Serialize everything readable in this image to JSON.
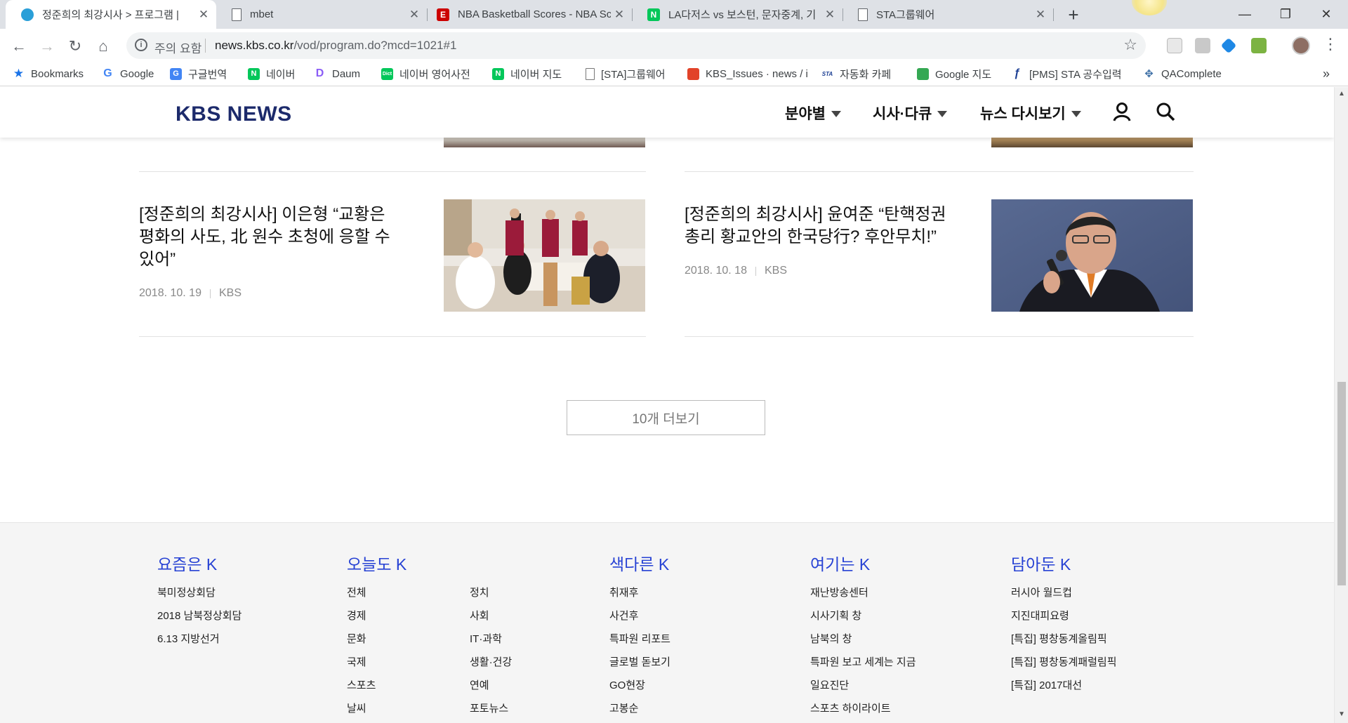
{
  "browser": {
    "tabs": [
      {
        "title": "정준희의 최강시사 > 프로그램 |",
        "icon": "kbs-icon",
        "active": true
      },
      {
        "title": "mbet",
        "icon": "page-icon",
        "active": false
      },
      {
        "title": "NBA Basketball Scores - NBA Sc",
        "icon": "espn-icon",
        "active": false
      },
      {
        "title": "LA다저스 vs 보스턴, 문자중계, 기",
        "icon": "naver-icon",
        "active": false
      },
      {
        "title": "STA그룹웨어",
        "icon": "page-icon",
        "active": false
      }
    ],
    "new_tab_label": "+",
    "window_controls": {
      "minimize": "—",
      "maximize": "❐",
      "close": "✕"
    },
    "security_label": "주의 요함",
    "url_host": "news.kbs.co.kr",
    "url_path": "/vod/program.do?mcd=1021#1",
    "bookmarks": [
      {
        "label": "Bookmarks",
        "icon": "star-icon",
        "color": "#1a73e8"
      },
      {
        "label": "Google",
        "icon": "google-icon",
        "color": "#4285f4"
      },
      {
        "label": "구글번역",
        "icon": "translate-icon",
        "color": "#4285f4"
      },
      {
        "label": "네이버",
        "icon": "naver-icon",
        "color": "#03c75a"
      },
      {
        "label": "Daum",
        "icon": "daum-icon",
        "color": "#8a5cf6"
      },
      {
        "label": "네이버 영어사전",
        "icon": "dict-icon",
        "color": "#03c75a"
      },
      {
        "label": "네이버 지도",
        "icon": "naver-icon",
        "color": "#03c75a"
      },
      {
        "label": "[STA]그룹웨어",
        "icon": "page-icon",
        "color": "#777777"
      },
      {
        "label": "KBS_Issues · news / i",
        "icon": "gitlab-icon",
        "color": "#e24329"
      },
      {
        "label": "자동화 카페",
        "icon": "sta-icon",
        "color": "#1c3f94"
      },
      {
        "label": "Google 지도",
        "icon": "maps-icon",
        "color": "#34a853"
      },
      {
        "label": "[PMS] STA 공수입력",
        "icon": "pms-icon",
        "color": "#1c3f94"
      },
      {
        "label": "QAComplete",
        "icon": "qa-icon",
        "color": "#3b6ea5"
      }
    ],
    "bookmarks_overflow": "»"
  },
  "site": {
    "logo": "KBS NEWS",
    "nav": [
      "분야별",
      "시사·다큐",
      "뉴스 다시보기"
    ],
    "colors": {
      "brand": "#1c2a6b",
      "accent": "#2742d4"
    }
  },
  "articles": [
    {
      "title": "[정준희의 최강시사] 이은형 “교황은 평화의 사도, 北 원수 초청에 응할 수 있어”",
      "date": "2018. 10. 19",
      "source": "KBS"
    },
    {
      "title": "[정준희의 최강시사] 윤여준 “탄핵정권 총리 황교안의 한국당行? 후안무치!”",
      "date": "2018. 10. 18",
      "source": "KBS"
    }
  ],
  "more_button": "10개 더보기",
  "footer": {
    "columns": [
      {
        "title": "요즘은 K",
        "links": [
          "북미정상회담",
          "2018 남북정상회담",
          "6.13 지방선거"
        ]
      },
      {
        "title": "오늘도 K",
        "links": [
          "전체",
          "경제",
          "문화",
          "국제",
          "스포츠",
          "날씨"
        ],
        "links2": [
          "정치",
          "사회",
          "IT·과학",
          "생활·건강",
          "연예",
          "포토뉴스"
        ]
      },
      {
        "title": "색다른 K",
        "links": [
          "취재후",
          "사건후",
          "특파원 리포트",
          "글로벌 돋보기",
          "GO현장",
          "고봉순"
        ]
      },
      {
        "title": "여기는 K",
        "links": [
          "재난방송센터",
          "시사기획 창",
          "남북의 창",
          "특파원 보고 세계는 지금",
          "일요진단",
          "스포츠 하이라이트"
        ]
      },
      {
        "title": "담아둔 K",
        "links": [
          "러시아 월드컵",
          "지진대피요령",
          "[특집] 평창동계올림픽",
          "[특집] 평창동계패럴림픽",
          "[특집] 2017대선"
        ]
      }
    ]
  }
}
